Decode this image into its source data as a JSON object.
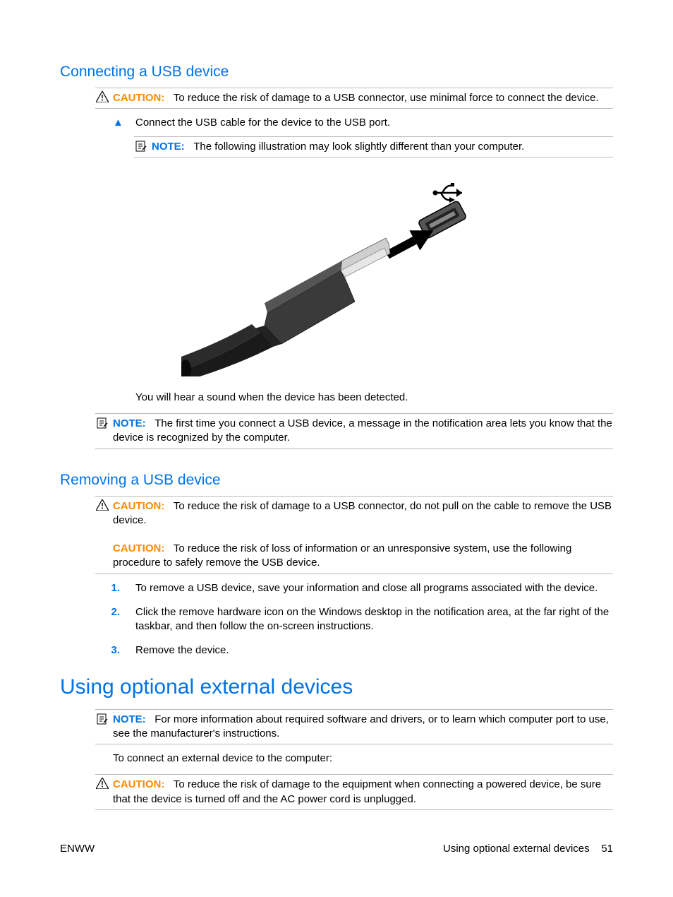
{
  "sections": {
    "s1": {
      "heading": "Connecting a USB device",
      "caution1_label": "CAUTION:",
      "caution1_text": "To reduce the risk of damage to a USB connector, use minimal force to connect the device.",
      "step1": "Connect the USB cable for the device to the USB port.",
      "note1_label": "NOTE:",
      "note1_text": "The following illustration may look slightly different than your computer.",
      "post_illus": "You will hear a sound when the device has been detected.",
      "note2_label": "NOTE:",
      "note2_text": "The first time you connect a USB device, a message in the notification area lets you know that the device is recognized by the computer."
    },
    "s2": {
      "heading": "Removing a USB device",
      "caution1_label": "CAUTION:",
      "caution1_text": "To reduce the risk of damage to a USB connector, do not pull on the cable to remove the USB device.",
      "caution2_label": "CAUTION:",
      "caution2_text": "To reduce the risk of loss of information or an unresponsive system, use the following procedure to safely remove the USB device.",
      "step1_num": "1.",
      "step1": "To remove a USB device, save your information and close all programs associated with the device.",
      "step2_num": "2.",
      "step2": "Click the remove hardware icon on the Windows desktop in the notification area, at the far right of the taskbar, and then follow the on-screen instructions.",
      "step3_num": "3.",
      "step3": "Remove the device."
    },
    "s3": {
      "heading": "Using optional external devices",
      "note1_label": "NOTE:",
      "note1_text": "For more information about required software and drivers, or to learn which computer port to use, see the manufacturer's instructions.",
      "para": "To connect an external device to the computer:",
      "caution1_label": "CAUTION:",
      "caution1_text": "To reduce the risk of damage to the equipment when connecting a powered device, be sure that the device is turned off and the AC power cord is unplugged."
    }
  },
  "footer": {
    "left": "ENWW",
    "right_text": "Using optional external devices",
    "right_page": "51"
  }
}
